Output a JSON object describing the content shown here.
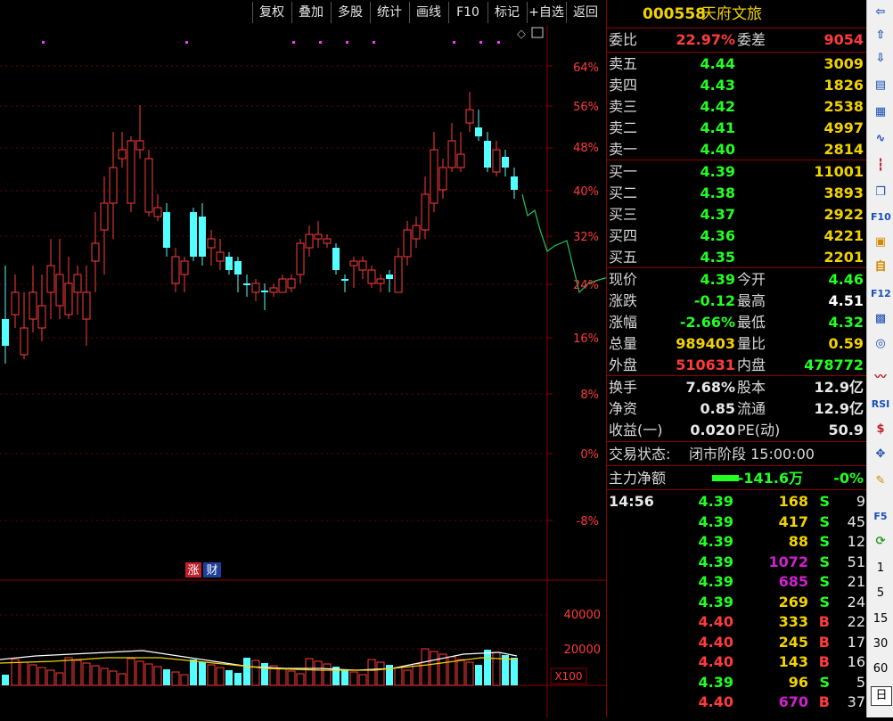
{
  "toolbar": {
    "buttons": [
      "复权",
      "叠加",
      "多股",
      "统计",
      "画线",
      "F10",
      "标记",
      "+自选",
      "返回"
    ]
  },
  "chart": {
    "pct_labels": [
      "64%",
      "56%",
      "48%",
      "40%",
      "32%",
      "24%",
      "16%",
      "8%",
      "0%",
      "-8%"
    ],
    "vol_labels": [
      "40000",
      "20000"
    ],
    "vol_unit": "X100",
    "badge_zhang": "涨",
    "badge_cai": "财",
    "colors": {
      "up": "#ff3b3b",
      "down": "#54ffff",
      "pct": "#ff3b3b",
      "green_line": "#22c55e"
    }
  },
  "stock": {
    "code": "000558",
    "name": "天府文旅"
  },
  "weibi": {
    "label": "委比",
    "value": "22.97%",
    "label2": "委差",
    "value2": "9054"
  },
  "sell": [
    {
      "label": "卖五",
      "price": "4.44",
      "vol": "3009"
    },
    {
      "label": "卖四",
      "price": "4.43",
      "vol": "1826"
    },
    {
      "label": "卖三",
      "price": "4.42",
      "vol": "2538"
    },
    {
      "label": "卖二",
      "price": "4.41",
      "vol": "4997"
    },
    {
      "label": "卖一",
      "price": "4.40",
      "vol": "2814"
    }
  ],
  "buy": [
    {
      "label": "买一",
      "price": "4.39",
      "vol": "11001"
    },
    {
      "label": "买二",
      "price": "4.38",
      "vol": "3893"
    },
    {
      "label": "买三",
      "price": "4.37",
      "vol": "2922"
    },
    {
      "label": "买四",
      "price": "4.36",
      "vol": "4221"
    },
    {
      "label": "买五",
      "price": "4.35",
      "vol": "2201"
    }
  ],
  "quote": [
    {
      "l1": "现价",
      "v1": "4.39",
      "l2": "今开",
      "v2": "4.46"
    },
    {
      "l1": "涨跌",
      "v1": "-0.12",
      "l2": "最高",
      "v2": "4.51"
    },
    {
      "l1": "涨幅",
      "v1": "-2.66%",
      "l2": "最低",
      "v2": "4.32"
    },
    {
      "l1": "总量",
      "v1": "989403",
      "l2": "量比",
      "v2": "0.59"
    },
    {
      "l1": "外盘",
      "v1": "510631",
      "l2": "内盘",
      "v2": "478772"
    }
  ],
  "fund": [
    {
      "l1": "换手",
      "v1": "7.68%",
      "l2": "股本",
      "v2": "12.9亿"
    },
    {
      "l1": "净资",
      "v1": "0.85",
      "l2": "流通",
      "v2": "12.9亿"
    },
    {
      "l1": "收益(一)",
      "v1": "0.020",
      "l2": "PE(动)",
      "v2": "50.9"
    }
  ],
  "status": {
    "label": "交易状态:",
    "value": "闭市阶段 15:00:00"
  },
  "main_flow": {
    "label": "主力净额",
    "value": "-141.6万",
    "pct": "-0%"
  },
  "ticks": [
    {
      "time": "14:56",
      "price": "4.39",
      "vol": "168",
      "side": "S",
      "n": "9"
    },
    {
      "time": "",
      "price": "4.39",
      "vol": "417",
      "side": "S",
      "n": "45"
    },
    {
      "time": "",
      "price": "4.39",
      "vol": "88",
      "side": "S",
      "n": "12"
    },
    {
      "time": "",
      "price": "4.39",
      "vol": "1072",
      "side": "S",
      "n": "51"
    },
    {
      "time": "",
      "price": "4.39",
      "vol": "685",
      "side": "S",
      "n": "21"
    },
    {
      "time": "",
      "price": "4.39",
      "vol": "269",
      "side": "S",
      "n": "24"
    },
    {
      "time": "",
      "price": "4.40",
      "vol": "333",
      "side": "B",
      "n": "22"
    },
    {
      "time": "",
      "price": "4.40",
      "vol": "245",
      "side": "B",
      "n": "17"
    },
    {
      "time": "",
      "price": "4.40",
      "vol": "143",
      "side": "B",
      "n": "16"
    },
    {
      "time": "",
      "price": "4.39",
      "vol": "96",
      "side": "S",
      "n": "5"
    },
    {
      "time": "",
      "price": "4.40",
      "vol": "670",
      "side": "B",
      "n": "37"
    }
  ],
  "sidebar": {
    "rsi": "RSI",
    "f5": "F5",
    "n1": "1",
    "n5": "5",
    "n15": "15",
    "n30": "30",
    "n60": "60",
    "day": "日"
  }
}
